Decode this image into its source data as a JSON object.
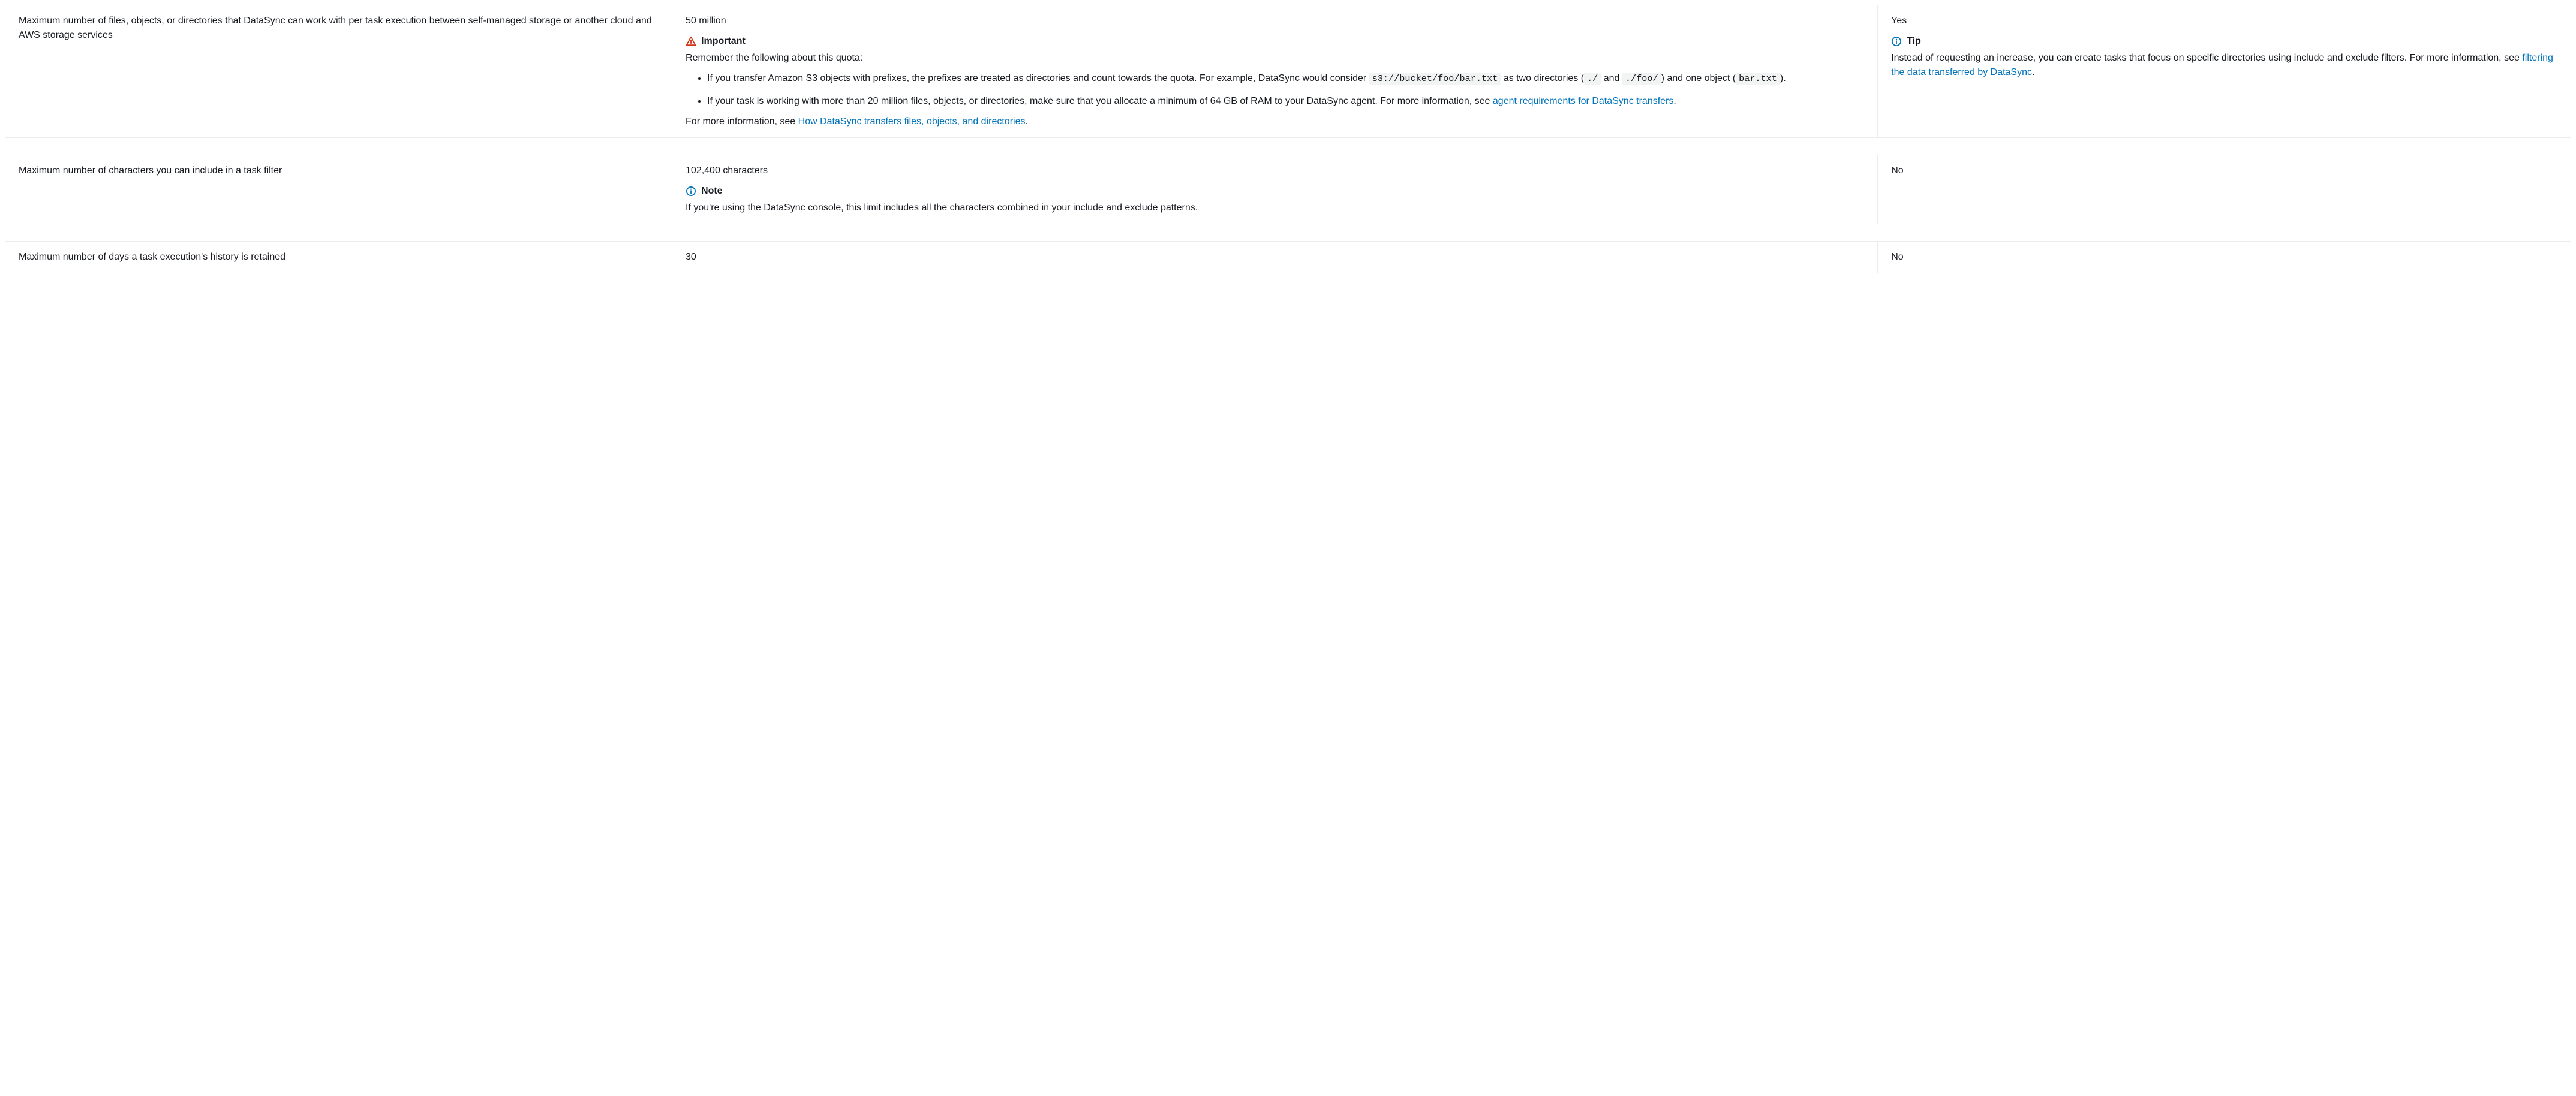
{
  "rows": [
    {
      "desc": "Maximum number of files, objects, or directories that DataSync can work with per task execution between self-managed storage or another cloud and AWS storage services",
      "quota_value": "50 million",
      "important_label": "Important",
      "important_intro": "Remember the following about this quota:",
      "bullet1_a": "If you transfer Amazon S3 objects with prefixes, the prefixes are treated as directories and count towards the quota. For example, DataSync would consider ",
      "code1": "s3://bucket/foo/bar.txt",
      "bullet1_b": " as two directories (",
      "code2": "./",
      "bullet1_c": " and ",
      "code3": "./foo/",
      "bullet1_d": ") and one object (",
      "code4": "bar.txt",
      "bullet1_e": ").",
      "bullet2_a": "If your task is working with more than 20 million files, objects, or directories, make sure that you allocate a minimum of 64 GB of RAM to your DataSync agent. For more information, see ",
      "link_agent": "agent requirements for DataSync transfers",
      "bullet2_b": ".",
      "more_info_a": "For more information, see ",
      "link_how": "How DataSync transfers files, objects, and directories",
      "more_info_b": ".",
      "adjustable": "Yes",
      "tip_label": "Tip",
      "tip_a": "Instead of requesting an increase, you can create tasks that focus on specific directories using include and exclude filters. For more information, see ",
      "link_filter": "filtering the data transferred by DataSync",
      "tip_b": "."
    },
    {
      "desc": "Maximum number of characters you can include in a task filter",
      "quota_value": "102,400 characters",
      "note_label": "Note",
      "note_body": "If you're using the DataSync console, this limit includes all the characters combined in your include and exclude patterns.",
      "adjustable": "No"
    },
    {
      "desc": "Maximum number of days a task execution's history is retained",
      "quota_value": "30",
      "adjustable": "No"
    }
  ]
}
